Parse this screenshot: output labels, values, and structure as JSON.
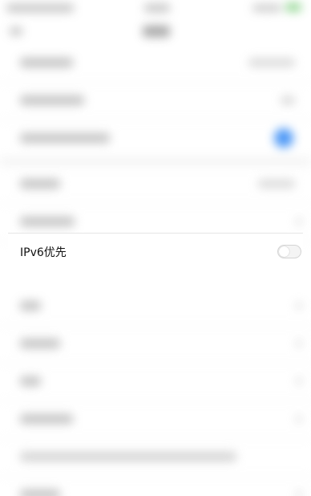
{
  "ipv6_row": {
    "label": "IPv6优先",
    "enabled": false
  },
  "colors": {
    "accent": "#3a8df5",
    "background": "#ffffff",
    "divider": "#eeeeee"
  },
  "icons": {
    "switch": "toggle-off-icon"
  }
}
